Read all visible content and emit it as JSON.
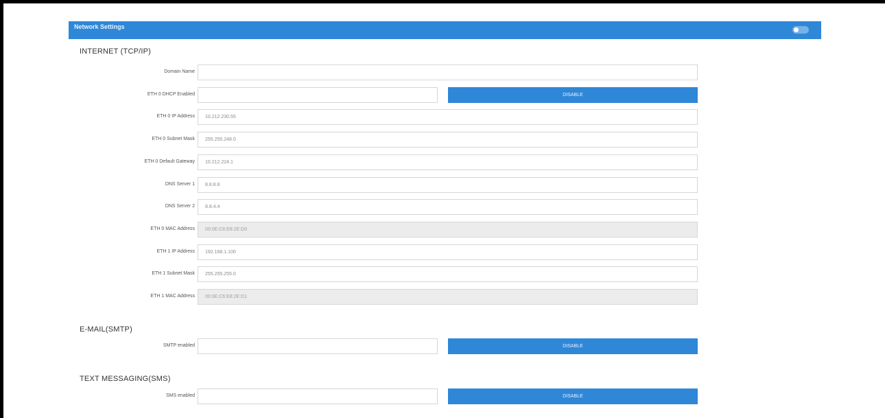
{
  "titlebar": {
    "title": "Network Settings"
  },
  "sections": {
    "internet": "INTERNET (TCP/IP)",
    "email": "E-MAIL(SMTP)",
    "sms": "TEXT MESSAGING(SMS)"
  },
  "internet": {
    "domain_name": {
      "label": "Domain Name",
      "value": ""
    },
    "dhcp": {
      "label": "ETH 0 DHCP Enabled",
      "value": "",
      "button": "DISABLE"
    },
    "eth0_ip": {
      "label": "ETH 0 IP Address",
      "value": "10.212.230.55"
    },
    "eth0_mask": {
      "label": "ETH 0 Subnet Mask",
      "value": "255.255.248.0"
    },
    "eth0_gateway": {
      "label": "ETH 0 Default Gateway",
      "value": "10.212.224.1"
    },
    "dns1": {
      "label": "DNS Server 1",
      "value": "8.8.8.8"
    },
    "dns2": {
      "label": "DNS Server 2",
      "value": "8.8.4.4"
    },
    "eth0_mac": {
      "label": "ETH 0 MAC Address",
      "value": "00:0E:C6:E8:2E:D0"
    },
    "eth1_ip": {
      "label": "ETH 1 IP Address",
      "value": "192.168.1.100"
    },
    "eth1_mask": {
      "label": "ETH 1 Subnet Mask",
      "value": "255.255.255.0"
    },
    "eth1_mac": {
      "label": "ETH 1 MAC Address",
      "value": "00:0E:C6:E8:2E:D1"
    }
  },
  "email": {
    "smtp": {
      "label": "SMTP enabled",
      "value": "",
      "button": "DISABLE"
    }
  },
  "sms": {
    "sms": {
      "label": "SMS enabled",
      "value": "",
      "button": "DISABLE"
    }
  }
}
